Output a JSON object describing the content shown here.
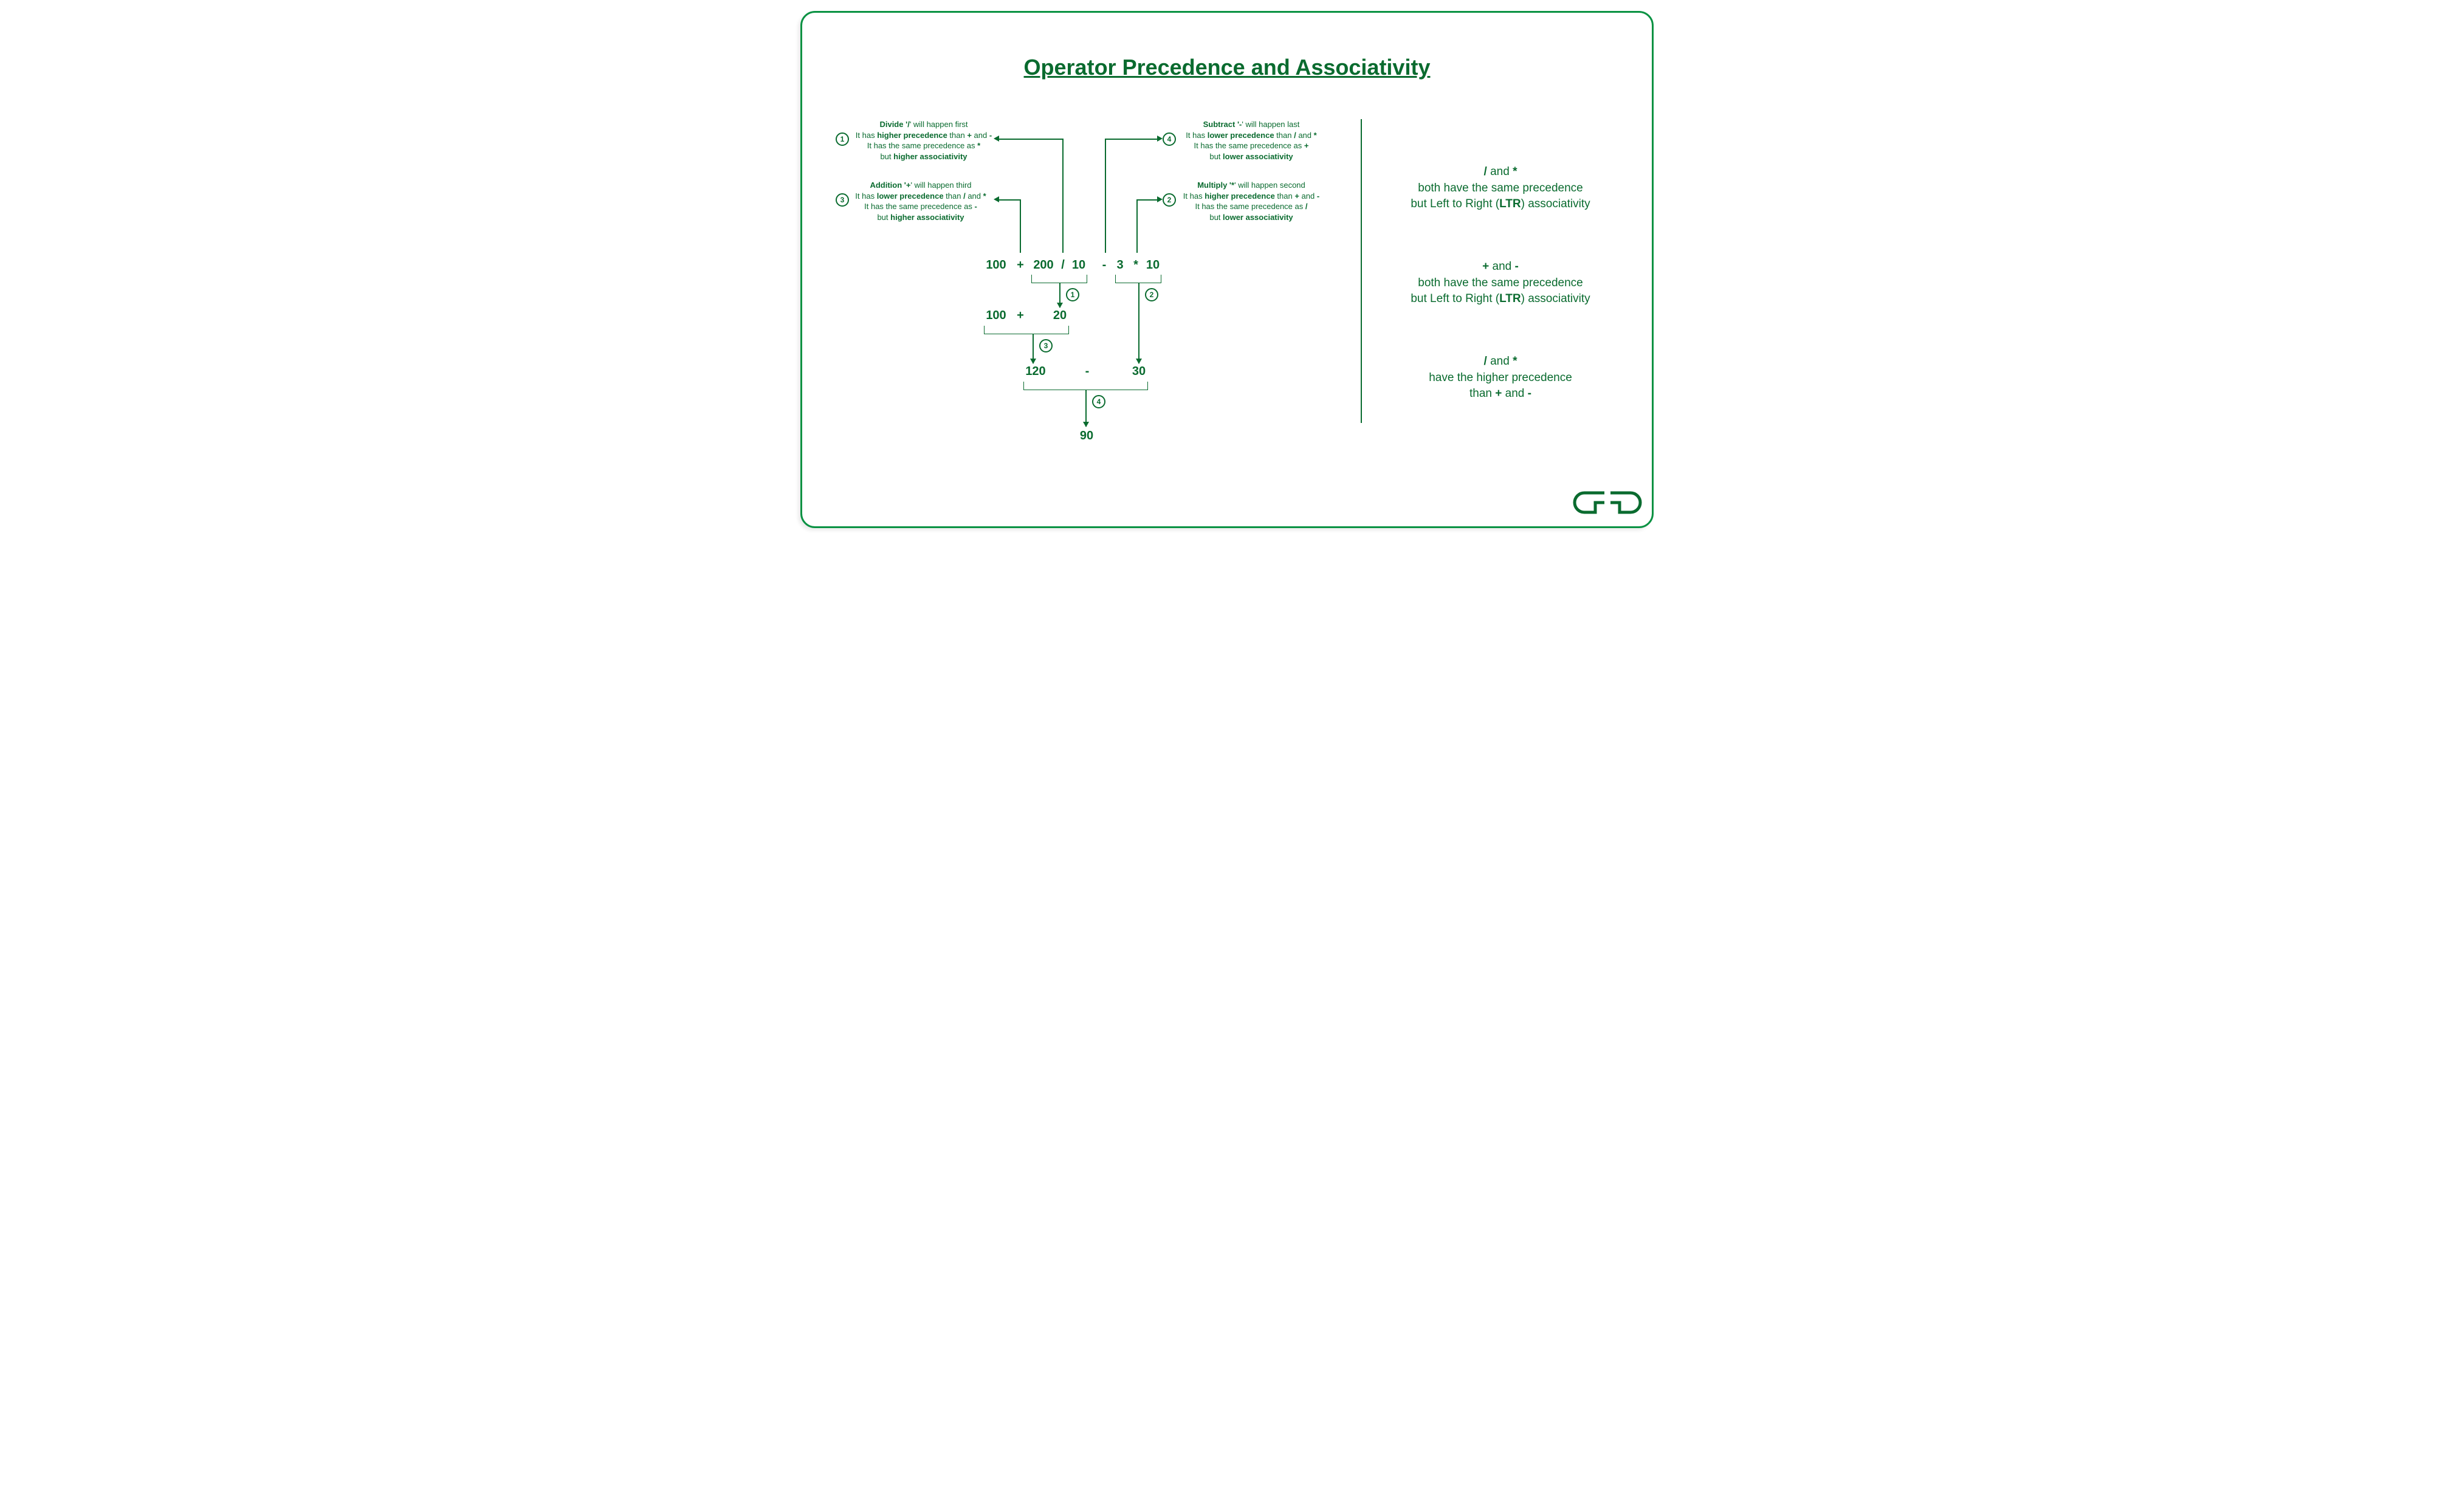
{
  "title": "Operator Precedence and Associativity",
  "annotations": {
    "a1": {
      "badge": "1",
      "l1a": "Divide '",
      "l1b": "/",
      "l1c": "' will happen first",
      "l2a": "It has ",
      "l2b": "higher precedence",
      "l2c": " than ",
      "l2d": "+",
      "l2e": " and ",
      "l2f": "-",
      "l3a": "It has the same precedence as ",
      "l3b": "*",
      "l4a": "but ",
      "l4b": "higher associativity"
    },
    "a2": {
      "badge": "2",
      "l1a": "Multiply '",
      "l1b": "*",
      "l1c": "' will happen second",
      "l2a": "It has ",
      "l2b": "higher precedence",
      "l2c": " than ",
      "l2d": "+",
      "l2e": " and ",
      "l2f": "-",
      "l3a": "It has the same precedence as ",
      "l3b": "/",
      "l4a": "but ",
      "l4b": "lower associativity"
    },
    "a3": {
      "badge": "3",
      "l1a": "Addition '",
      "l1b": "+",
      "l1c": "' will happen third",
      "l2a": "It has ",
      "l2b": "lower precedence",
      "l2c": " than ",
      "l2d": "/",
      "l2e": " and ",
      "l2f": "*",
      "l3a": "It has the same precedence as ",
      "l3b": "-",
      "l4a": "but ",
      "l4b": "higher associativity"
    },
    "a4": {
      "badge": "4",
      "l1a": "Subtract '",
      "l1b": "-",
      "l1c": "' will happen last",
      "l2a": "It has ",
      "l2b": "lower precedence",
      "l2c": " than ",
      "l2d": "/",
      "l2e": " and ",
      "l2f": "*",
      "l3a": "It has the same precedence as ",
      "l3b": "+",
      "l4a": "but ",
      "l4b": "lower associativity"
    }
  },
  "expression": {
    "row1": {
      "t1": "100",
      "op1": "+",
      "t2": "200",
      "op2": "/",
      "t3": "10",
      "op3": "-",
      "t4": "3",
      "op4": "*",
      "t5": "10"
    },
    "row2": {
      "t1": "100",
      "op1": "+",
      "t2": "20"
    },
    "row3": {
      "t1": "120",
      "op1": "-",
      "t2": "30"
    },
    "row4": {
      "t1": "90"
    }
  },
  "steps": {
    "s1": "1",
    "s2": "2",
    "s3": "3",
    "s4": "4"
  },
  "right_notes": {
    "n1": {
      "p1a": "/",
      "p1b": " and ",
      "p1c": "*",
      "p2": "both have the same precedence",
      "p3a": "but Left to Right (",
      "p3b": "LTR",
      "p3c": ") associativity"
    },
    "n2": {
      "p1a": "+",
      "p1b": " and ",
      "p1c": "-",
      "p2": "both have the same precedence",
      "p3a": "but Left to Right (",
      "p3b": "LTR",
      "p3c": ") associativity"
    },
    "n3": {
      "p1a": "/",
      "p1b": " and ",
      "p1c": "*",
      "p2": "have the higher precedence",
      "p3a": "than ",
      "p3b": "+",
      "p3c": " and ",
      "p3d": "-"
    }
  }
}
